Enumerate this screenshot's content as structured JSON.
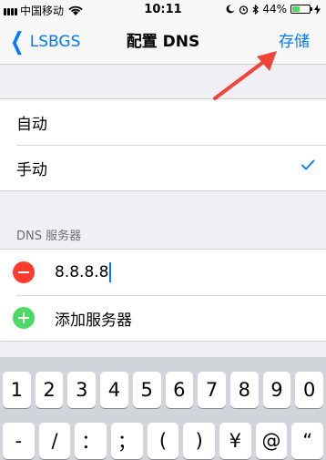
{
  "status_bar": {
    "carrier": "中国移动",
    "time": "10:11",
    "battery_percent": "44%",
    "battery_level": 0.44
  },
  "nav": {
    "back_label": "LSBGS",
    "title": "配置 DNS",
    "save_label": "存储"
  },
  "mode_options": [
    {
      "label": "自动",
      "selected": false
    },
    {
      "label": "手动",
      "selected": true
    }
  ],
  "dns_section": {
    "header": "DNS 服务器",
    "servers": [
      "8.8.8.8"
    ],
    "add_label": "添加服务器"
  },
  "keyboard": {
    "row1": [
      "1",
      "2",
      "3",
      "4",
      "5",
      "6",
      "7",
      "8",
      "9",
      "0"
    ],
    "row2": [
      "-",
      "/",
      "：",
      "；",
      "(",
      ")",
      "¥",
      "@",
      "“"
    ]
  },
  "colors": {
    "accent": "#007aff",
    "delete": "#ff3b30",
    "add": "#4cd964",
    "annotation_arrow": "#f04438"
  }
}
